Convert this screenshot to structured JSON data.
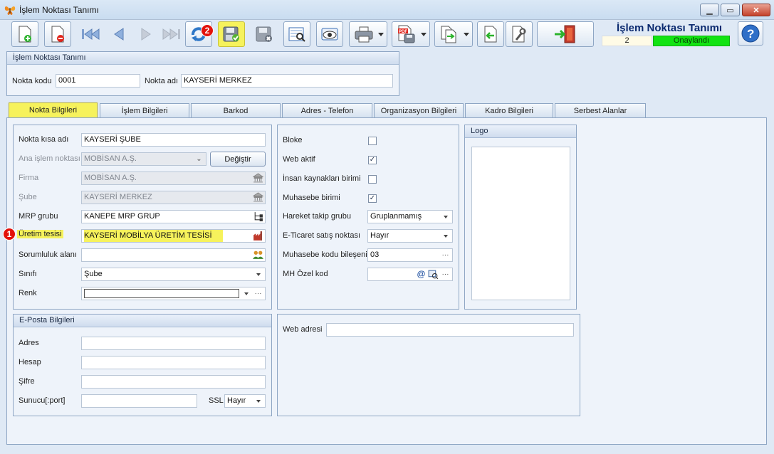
{
  "window": {
    "title": "İşlem Noktası Tanımı"
  },
  "header": {
    "heading": "İşlem Noktası Tanımı",
    "number": "2",
    "status": "Onaylandı",
    "status_color": "#12e312"
  },
  "toolbar": {
    "buttons": [
      "new-document-icon",
      "delete-document-icon",
      "first-record-icon",
      "previous-record-icon",
      "next-record-icon",
      "last-record-icon",
      "refresh-icon",
      "save-icon",
      "cancel-save-icon",
      "preview-icon",
      "view-icon",
      "print-icon",
      "pdf-export-icon",
      "copy-icon",
      "back-icon",
      "settings-icon",
      "exit-icon",
      "help-icon"
    ],
    "badge_refresh": "2",
    "highlight_color": "#f6f25c"
  },
  "top_group": {
    "title": "İşlem Noktası Tanımı",
    "code_label": "Nokta kodu",
    "code_value": "0001",
    "name_label": "Nokta adı",
    "name_value": "KAYSERİ MERKEZ"
  },
  "tabs": [
    "Nokta Bilgileri",
    "İşlem Bilgileri",
    "Barkod",
    "Adres - Telefon",
    "Organizasyon Bilgileri",
    "Kadro Bilgileri",
    "Serbest Alanlar"
  ],
  "left_form": {
    "short_name": {
      "label": "Nokta kısa adı",
      "value": "KAYSERİ ŞUBE"
    },
    "main_point": {
      "label": "Ana işlem noktası",
      "value": "MOBİSAN A.Ş.",
      "button": "Değiştir"
    },
    "company": {
      "label": "Firma",
      "value": "MOBİSAN A.Ş."
    },
    "branch": {
      "label": "Şube",
      "value": "KAYSERİ MERKEZ"
    },
    "mrp_group": {
      "label": "MRP grubu",
      "value": "KANEPE MRP GRUP"
    },
    "production": {
      "label": "Üretim tesisi",
      "value": "KAYSERİ MOBİLYA ÜRETİM TESİSİ",
      "badge": "1"
    },
    "responsibility": {
      "label": "Sorumluluk alanı",
      "value": ""
    },
    "class": {
      "label": "Sınıfı",
      "value": "Şube"
    },
    "color": {
      "label": "Renk",
      "value": ""
    }
  },
  "right_form": {
    "blocked": {
      "label": "Bloke",
      "checked": false
    },
    "web_active": {
      "label": "Web aktif",
      "checked": true
    },
    "hr_unit": {
      "label": "İnsan kaynakları birimi",
      "checked": false
    },
    "accounting_unit": {
      "label": "Muhasebe birimi",
      "checked": true
    },
    "movement_group": {
      "label": "Hareket takip grubu",
      "value": "Gruplanmamış"
    },
    "ecommerce": {
      "label": "E-Ticaret satış noktası",
      "value": "Hayır"
    },
    "accounting_code": {
      "label": "Muhasebe kodu bileşeni",
      "value": "03"
    },
    "mh_code": {
      "label": "MH Özel kod",
      "value": ""
    }
  },
  "logo_group": {
    "title": "Logo"
  },
  "email_group": {
    "title": "E-Posta Bilgileri",
    "address_label": "Adres",
    "address_value": "",
    "account_label": "Hesap",
    "account_value": "",
    "password_label": "Şifre",
    "password_value": "",
    "server_label": "Sunucu[:port]",
    "server_value": "",
    "ssl_label": "SSL",
    "ssl_value": "Hayır"
  },
  "web_group": {
    "label": "Web adresi",
    "value": ""
  }
}
